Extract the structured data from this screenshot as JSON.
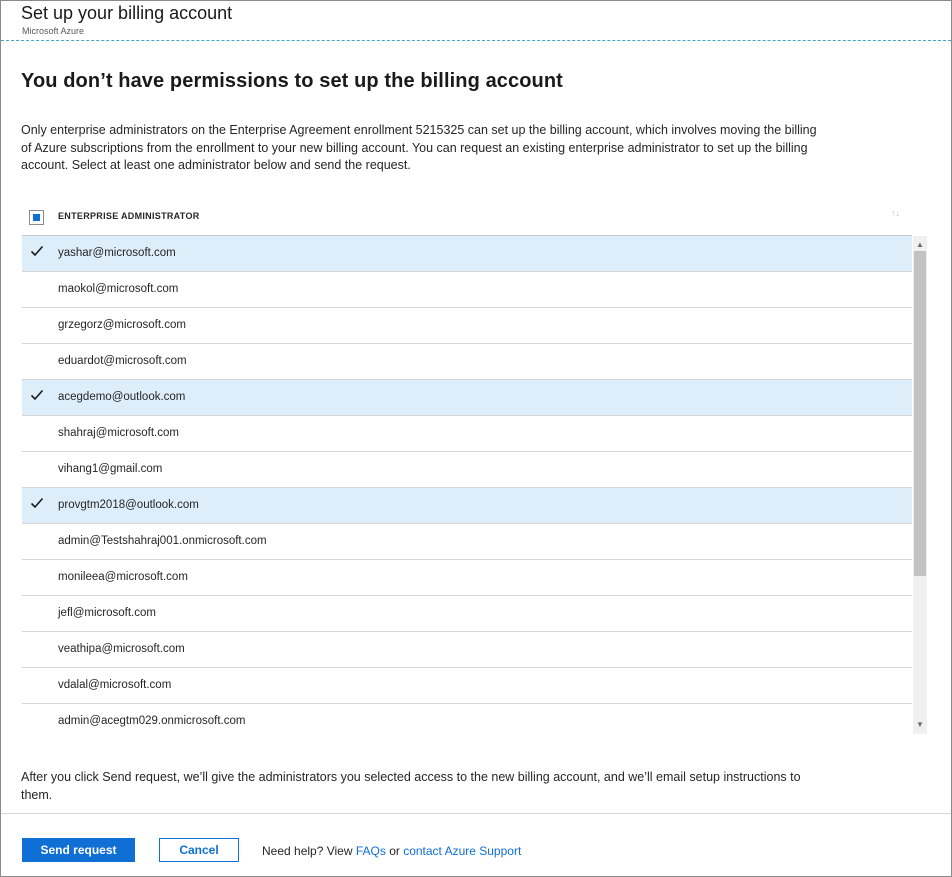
{
  "header": {
    "title": "Set up your billing account",
    "subtitle": "Microsoft Azure"
  },
  "main": {
    "heading": "You don’t have permissions to set up the billing account",
    "description": "Only enterprise administrators on the Enterprise Agreement enrollment 5215325 can set up the billing account, which involves moving the billing of Azure subscriptions from the enrollment to your new billing account. You can request an existing enterprise administrator to set up the billing account. Select at least one administrator below and send the request."
  },
  "table": {
    "column_header": "ENTERPRISE ADMINISTRATOR",
    "sort_icon": "sort-arrows-icon",
    "header_checkbox_state": "partial",
    "rows": [
      {
        "email": "yashar@microsoft.com",
        "selected": true
      },
      {
        "email": "maokol@microsoft.com",
        "selected": false
      },
      {
        "email": "grzegorz@microsoft.com",
        "selected": false
      },
      {
        "email": "eduardot@microsoft.com",
        "selected": false
      },
      {
        "email": "acegdemo@outlook.com",
        "selected": true
      },
      {
        "email": "shahraj@microsoft.com",
        "selected": false
      },
      {
        "email": "vihang1@gmail.com",
        "selected": false
      },
      {
        "email": "provgtm2018@outlook.com",
        "selected": true
      },
      {
        "email": "admin@Testshahraj001.onmicrosoft.com",
        "selected": false
      },
      {
        "email": "monileea@microsoft.com",
        "selected": false
      },
      {
        "email": "jefl@microsoft.com",
        "selected": false
      },
      {
        "email": "veathipa@microsoft.com",
        "selected": false
      },
      {
        "email": "vdalal@microsoft.com",
        "selected": false
      },
      {
        "email": "admin@acegtm029.onmicrosoft.com",
        "selected": false
      }
    ]
  },
  "footer": {
    "note": "After you click Send request, we’ll give the administrators you selected access to the new billing account, and we’ll email setup instructions to them.",
    "send_label": "Send request",
    "cancel_label": "Cancel",
    "help_prefix": "Need help? View ",
    "faqs_label": "FAQs",
    "help_middle": " or ",
    "support_label": "contact Azure Support"
  },
  "colors": {
    "accent": "#0f6fd4",
    "selected_row": "#ddeefa",
    "header_divider": "#3da8c4"
  }
}
